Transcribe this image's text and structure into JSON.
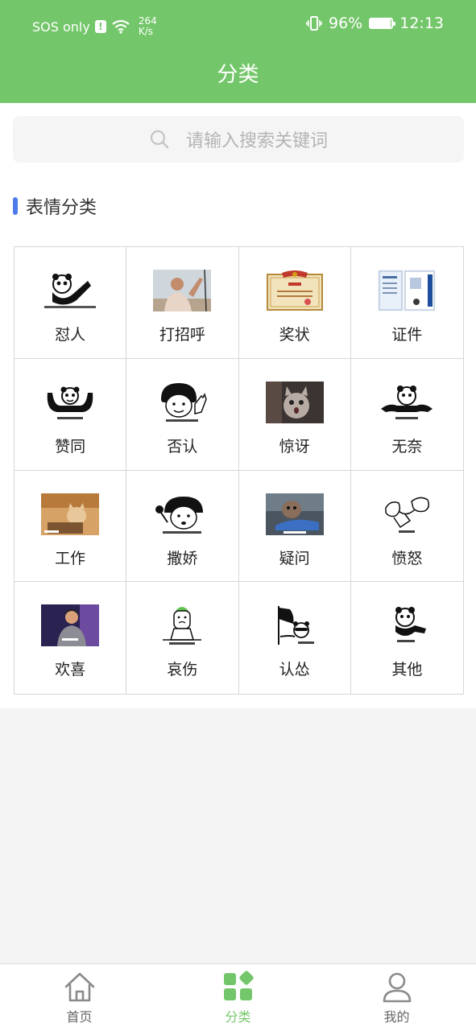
{
  "status_bar": {
    "carrier": "SOS only",
    "alert": "!",
    "net_speed_value": "264",
    "net_speed_unit": "K/s",
    "battery": "96%",
    "time": "12:13"
  },
  "header": {
    "title": "分类"
  },
  "search": {
    "placeholder": "请输入搜索关键词"
  },
  "section": {
    "title": "表情分类"
  },
  "categories": [
    {
      "label": "怼人",
      "icon": "panda-meme-thumb"
    },
    {
      "label": "打招呼",
      "icon": "man-waving-photo-thumb"
    },
    {
      "label": "奖状",
      "icon": "certificate-thumb"
    },
    {
      "label": "证件",
      "icon": "id-card-thumb"
    },
    {
      "label": "赞同",
      "icon": "panda-meme-thumb"
    },
    {
      "label": "否认",
      "icon": "mushroom-head-meme-thumb"
    },
    {
      "label": "惊讶",
      "icon": "cat-photo-thumb"
    },
    {
      "label": "无奈",
      "icon": "panda-meme-thumb"
    },
    {
      "label": "工作",
      "icon": "cat-at-laptop-thumb"
    },
    {
      "label": "撒娇",
      "icon": "mushroom-head-meme-thumb"
    },
    {
      "label": "疑问",
      "icon": "dog-in-car-thumb"
    },
    {
      "label": "愤怒",
      "icon": "sketch-meme-thumb"
    },
    {
      "label": "欢喜",
      "icon": "man-on-stage-thumb"
    },
    {
      "label": "哀伤",
      "icon": "sad-figure-meme-thumb"
    },
    {
      "label": "认怂",
      "icon": "panda-flag-meme-thumb"
    },
    {
      "label": "其他",
      "icon": "panda-meme-thumb"
    }
  ],
  "nav": {
    "home": "首页",
    "category": "分类",
    "mine": "我的"
  },
  "colors": {
    "header_bg": "#74c66a",
    "accent": "#4c7bea",
    "active_nav": "#74c66a"
  }
}
